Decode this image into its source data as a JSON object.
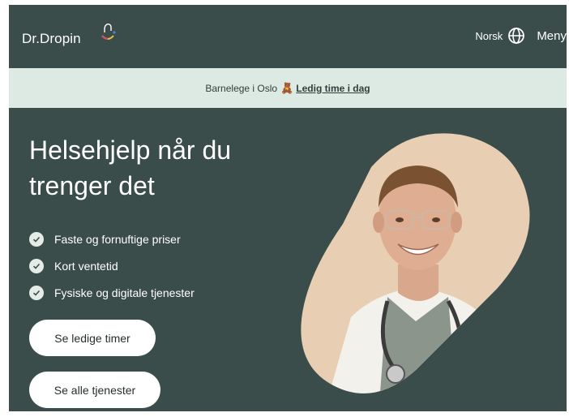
{
  "header": {
    "logo_text": "Dr.Dropin",
    "language": "Norsk",
    "menu_label": "Meny",
    "globe_icon": "globe-icon"
  },
  "banner": {
    "text": "Barnelege i Oslo",
    "emoji": "🧸",
    "link": "Ledig time i dag"
  },
  "hero": {
    "title": "Helsehjelp når du trenger det",
    "features": [
      "Faste og fornuftige priser",
      "Kort ventetid",
      "Fysiske og digitale tjenester"
    ],
    "primary_button": "Se ledige timer",
    "secondary_button": "Se alle tjenester"
  },
  "colors": {
    "background": "#3a4d4b",
    "banner": "#dde9e3",
    "photo_backdrop": "#e8cfb4",
    "button": "#ffffff"
  }
}
